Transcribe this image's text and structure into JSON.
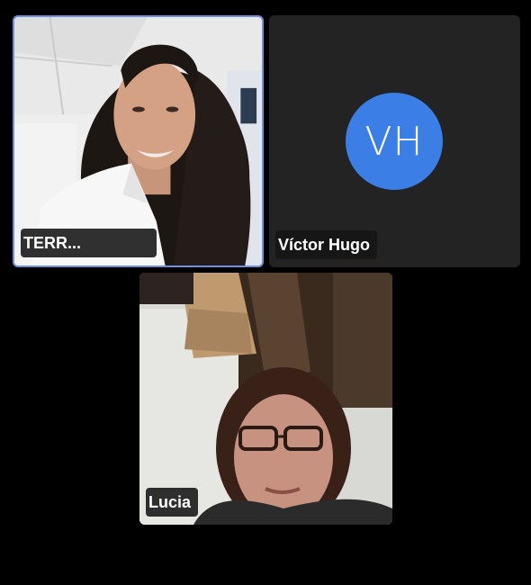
{
  "participants": [
    {
      "label": "TERR...",
      "speaking": true,
      "has_video": true
    },
    {
      "label": "Víctor Hugo",
      "initials": "VH",
      "speaking": false,
      "has_video": false,
      "avatar_color": "#3b7fe6"
    },
    {
      "label": "Lucia",
      "speaking": false,
      "has_video": true
    }
  ],
  "colors": {
    "background": "#000000",
    "tile_background": "#232323",
    "active_speaker_border": "#6f8fe3",
    "avatar": "#3b7fe6"
  }
}
